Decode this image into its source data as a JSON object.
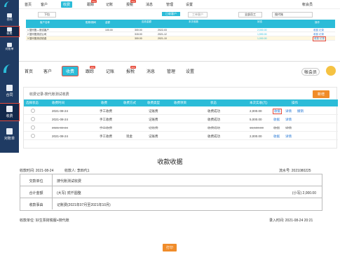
{
  "top": {
    "nav": [
      "首页",
      "客户",
      "收费",
      "跟踪",
      "记账",
      "报税",
      "消息",
      "管理",
      "设置"
    ],
    "active_nav": "收费",
    "new_badge": "new",
    "user": "帐会员",
    "side": [
      "合同",
      "收费",
      "对账单"
    ],
    "filter_label": "下拉",
    "tabs": [
      "已收客户",
      "工单客户"
    ],
    "select_placeholder": "全部员工",
    "search_value": "搜代账",
    "header": [
      "客户名称",
      "账期/期间",
      "金额",
      "应收金额",
      "本次收款",
      "状态",
      "操作"
    ],
    "subheader": [
      "已收金额",
      "最近日期",
      "已收服务(月)",
      "最近日期",
      "收款金额",
      "应收日期",
      "操作"
    ],
    "rows": [
      {
        "name": "1 搜代账—测试客户",
        "amount": "100.00",
        "due": "300.00",
        "date": "2022-03",
        "money": "2,000.00",
        "op": "收费 记录"
      },
      {
        "name": "2 搜代账测试公司",
        "amount": "",
        "due": "315.00",
        "date": "2021-12",
        "money": "1,590.00",
        "op": "收费 记录"
      },
      {
        "name": "3 搜代账测试收费",
        "amount": "",
        "due": "300.00",
        "date": "2021-10",
        "money": "1,000.00",
        "op": "收费 记录"
      }
    ]
  },
  "mid": {
    "nav": [
      "首页",
      "客户",
      "收费",
      "跟踪",
      "记账",
      "报税",
      "消息",
      "管理",
      "设置"
    ],
    "active_nav": "收费",
    "new_badge": "new",
    "user": "帐会员",
    "side": [
      "合同",
      "收费",
      "对账单"
    ],
    "panel_title": "收费记录-搜代账测试收费",
    "add_button": "新增",
    "columns": [
      "选择状态",
      "收费时间",
      "收费",
      "收费方式",
      "收费类型",
      "收费项目",
      "状态",
      "本次实收(元)",
      "操作"
    ],
    "rows": [
      {
        "date": "2021-08-24",
        "source": "手工收费",
        "method": "",
        "type": "记账费",
        "status": "收费成功",
        "amount": "2,000.00",
        "ops": [
          "收据",
          "详情",
          "撤销"
        ],
        "strike": false
      },
      {
        "date": "2021-08-24",
        "source": "手工收费",
        "method": "",
        "type": "记账费",
        "status": "收费成功",
        "amount": "5,000.00",
        "ops": [
          "收据",
          "详情"
        ],
        "strike": false
      },
      {
        "date": "2021-08-24",
        "source": "手工收费",
        "method": "",
        "type": "记账费",
        "status": "收费成功",
        "amount": "15,500.00",
        "ops": [
          "收据",
          "详情"
        ],
        "strike": true
      },
      {
        "date": "2021-08-24",
        "source": "手工收费",
        "method": "现金",
        "type": "记账费",
        "status": "收费成功",
        "amount": "2,000.00",
        "ops": [
          "收据",
          "详情"
        ],
        "strike": false
      }
    ]
  },
  "receipt": {
    "title": "收款收据",
    "time": "收款时间: 2021-08-24",
    "payee": "收款人: 李四代1",
    "serial": "流水号: 2021080225",
    "rows": [
      {
        "label": "交款单位",
        "value": "搜代账测试收费"
      },
      {
        "label": "合计金额",
        "value": "(大写) 贰仟圆整",
        "extra": "(小写) 2,000.00"
      },
      {
        "label": "收款事由",
        "value": "记账费(2021年07月至2021年10月)"
      }
    ],
    "footer_left": "收款单位: 好生票财税服+搜代账",
    "footer_right": "录入时间: 2021-08-24 20:21",
    "print_button": "打印"
  }
}
